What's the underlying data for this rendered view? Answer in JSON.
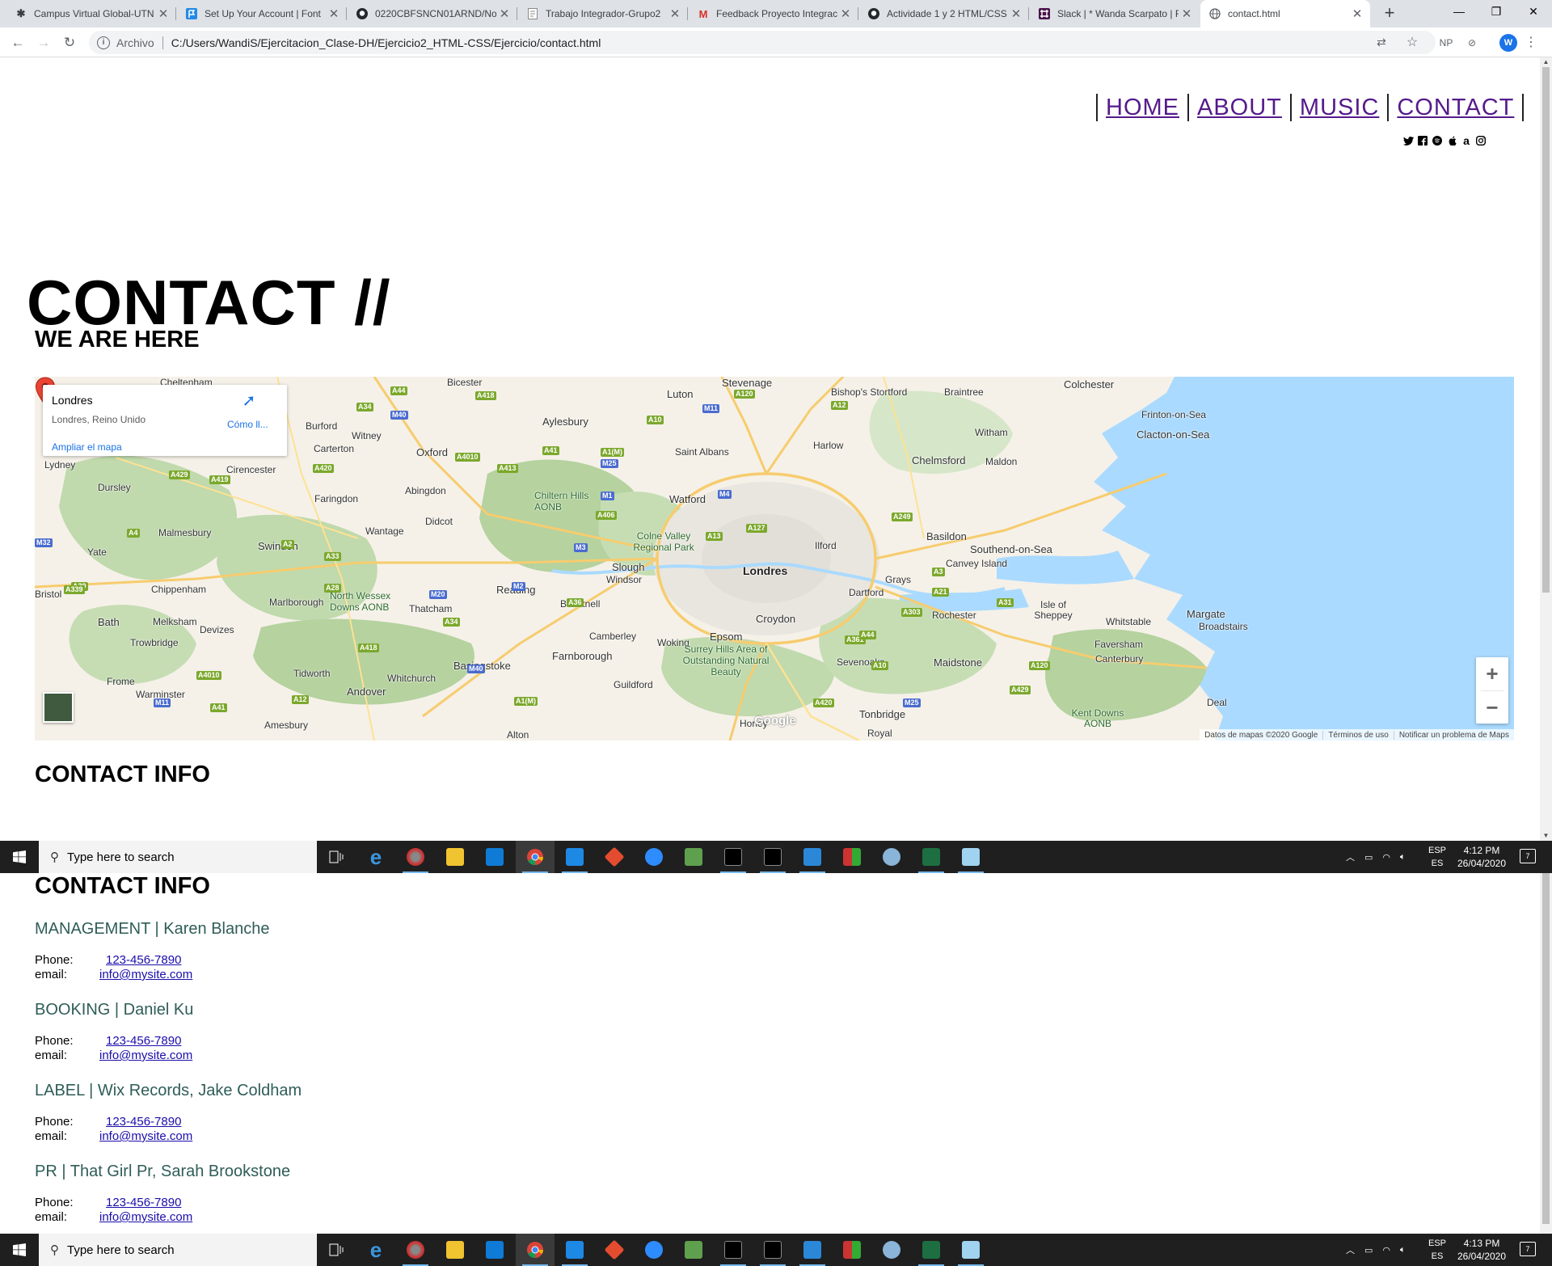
{
  "browser": {
    "tabs": [
      {
        "title": "Campus Virtual Global-UTN",
        "icon": "utn-asterisk-icon"
      },
      {
        "title": "Set Up Your Account | Font",
        "icon": "fontawesome-flag-icon"
      },
      {
        "title": "0220CBFSNCN01ARND/No",
        "icon": "github-icon"
      },
      {
        "title": "Trabajo Integrador-Grupo2",
        "icon": "document-icon"
      },
      {
        "title": "Feedback Proyecto Integrac",
        "icon": "gmail-icon"
      },
      {
        "title": "Actividade 1 y 2 HTML/CSS",
        "icon": "github-icon"
      },
      {
        "title": "Slack | * Wanda Scarpato | F",
        "icon": "slack-icon"
      },
      {
        "title": "contact.html",
        "icon": "globe-icon"
      }
    ],
    "address": {
      "scheme_label": "Archivo",
      "url": "C:/Users/WandiS/Ejercitacion_Clase-DH/Ejercicio2_HTML-CSS/Ejercicio/contact.html"
    },
    "extensions": [
      "NP"
    ],
    "profile_initial": "W"
  },
  "page": {
    "nav": [
      "HOME",
      "ABOUT",
      "MUSIC",
      "CONTACT"
    ],
    "social_icons": [
      "twitter-icon",
      "facebook-icon",
      "spotify-icon",
      "apple-icon",
      "amazon-icon",
      "instagram-icon"
    ],
    "title": "CONTACT //",
    "map_heading": "WE ARE HERE",
    "info_heading": "CONTACT INFO"
  },
  "map": {
    "place": "Londres",
    "address": "Londres, Reino Unido",
    "directions_label": "Cómo ll...",
    "enlarge_label": "Ampliar el mapa",
    "pin_label": "Londres",
    "logo": "Google",
    "footer": [
      "Datos de mapas ©2020 Google",
      "Términos de uso",
      "Notificar un problema de Maps"
    ],
    "labels": [
      "Cheltenham",
      "Bicester",
      "Stevenage",
      "Luton",
      "Bishop's Stortford",
      "Braintree",
      "Colchester",
      "Frinton-on-Sea",
      "Clacton-on-Sea",
      "Aylesbury",
      "Burford",
      "Witney",
      "Carterton",
      "Oxford",
      "Saint Albans",
      "Harlow",
      "Witham",
      "Chelmsford",
      "Maldon",
      "Cirencester",
      "Lydney",
      "Dursley",
      "Faringdon",
      "Abingdon",
      "Chiltern Hills AONB",
      "Watford",
      "Didcot",
      "Wantage",
      "Malmesbury",
      "Swindon",
      "Colne Valley Regional Park",
      "Ilford",
      "Basildon",
      "Southend-on-Sea",
      "Canvey Island",
      "Yate",
      "Slough",
      "Windsor",
      "Grays",
      "Chippenham",
      "Reading",
      "Bracknell",
      "Dartford",
      "Marlborough",
      "North Wessex Downs AONB",
      "Thatcham",
      "Bath",
      "Melksham",
      "Devizes",
      "Croydon",
      "Rochester",
      "Isle of Sheppey",
      "Whitstable",
      "Margate",
      "Broadstairs",
      "Trowbridge",
      "Camberley",
      "Woking",
      "Epsom",
      "Faversham",
      "Basingstoke",
      "Farnborough",
      "Surrey Hills Area of Outstanding Natural Beauty",
      "Sevenoaks",
      "Maidstone",
      "Canterbury",
      "Frome",
      "Tidworth",
      "Whitchurch",
      "Guildford",
      "Deal",
      "Warminster",
      "Andover",
      "Horley",
      "Tonbridge",
      "Kent Downs AONB",
      "Amesbury",
      "Alton",
      "Royal",
      "Bristol"
    ],
    "roads": [
      "A44",
      "A418",
      "A34",
      "M40",
      "A10",
      "A120",
      "M11",
      "A12",
      "A4010",
      "A41",
      "A1(M)",
      "M25",
      "A420",
      "A429",
      "A419",
      "A413",
      "M1",
      "A406",
      "M4",
      "A127",
      "A13",
      "M32",
      "A4",
      "A2",
      "A33",
      "M3",
      "A249",
      "A39",
      "A3",
      "M20",
      "M2",
      "A339",
      "A28",
      "A21",
      "A36",
      "A303",
      "A31",
      "A361"
    ]
  },
  "contacts": [
    {
      "role": "MANAGEMENT | Karen Blanche",
      "phone_label": "Phone:",
      "phone": "123-456-7890",
      "email_label": "email:",
      "email": "info@mysite.com"
    },
    {
      "role": "BOOKING | Daniel Ku",
      "phone_label": "Phone:",
      "phone": "123-456-7890",
      "email_label": "email:",
      "email": "info@mysite.com"
    },
    {
      "role": "LABEL | Wix Records, Jake Coldham",
      "phone_label": "Phone:",
      "phone": "123-456-7890",
      "email_label": "email:",
      "email": "info@mysite.com"
    },
    {
      "role": "PR | That Girl Pr, Sarah Brookstone",
      "phone_label": "Phone:",
      "phone": "123-456-7890",
      "email_label": "email:",
      "email": "info@mysite.com"
    }
  ],
  "taskbars": [
    {
      "search_placeholder": "Type here to search",
      "lang_top": "ESP",
      "lang_bottom": "ES",
      "time": "4:12 PM",
      "date": "26/04/2020",
      "notif_count": "7"
    },
    {
      "search_placeholder": "Type here to search",
      "lang_top": "ESP",
      "lang_bottom": "ES",
      "time": "4:13 PM",
      "date": "26/04/2020",
      "notif_count": "7"
    }
  ],
  "colors": {
    "link_visited": "#551a8b",
    "role_text": "#2f5d57",
    "link": "#1a0dab",
    "map_water": "#aadaff",
    "map_park": "#b5d29f"
  }
}
